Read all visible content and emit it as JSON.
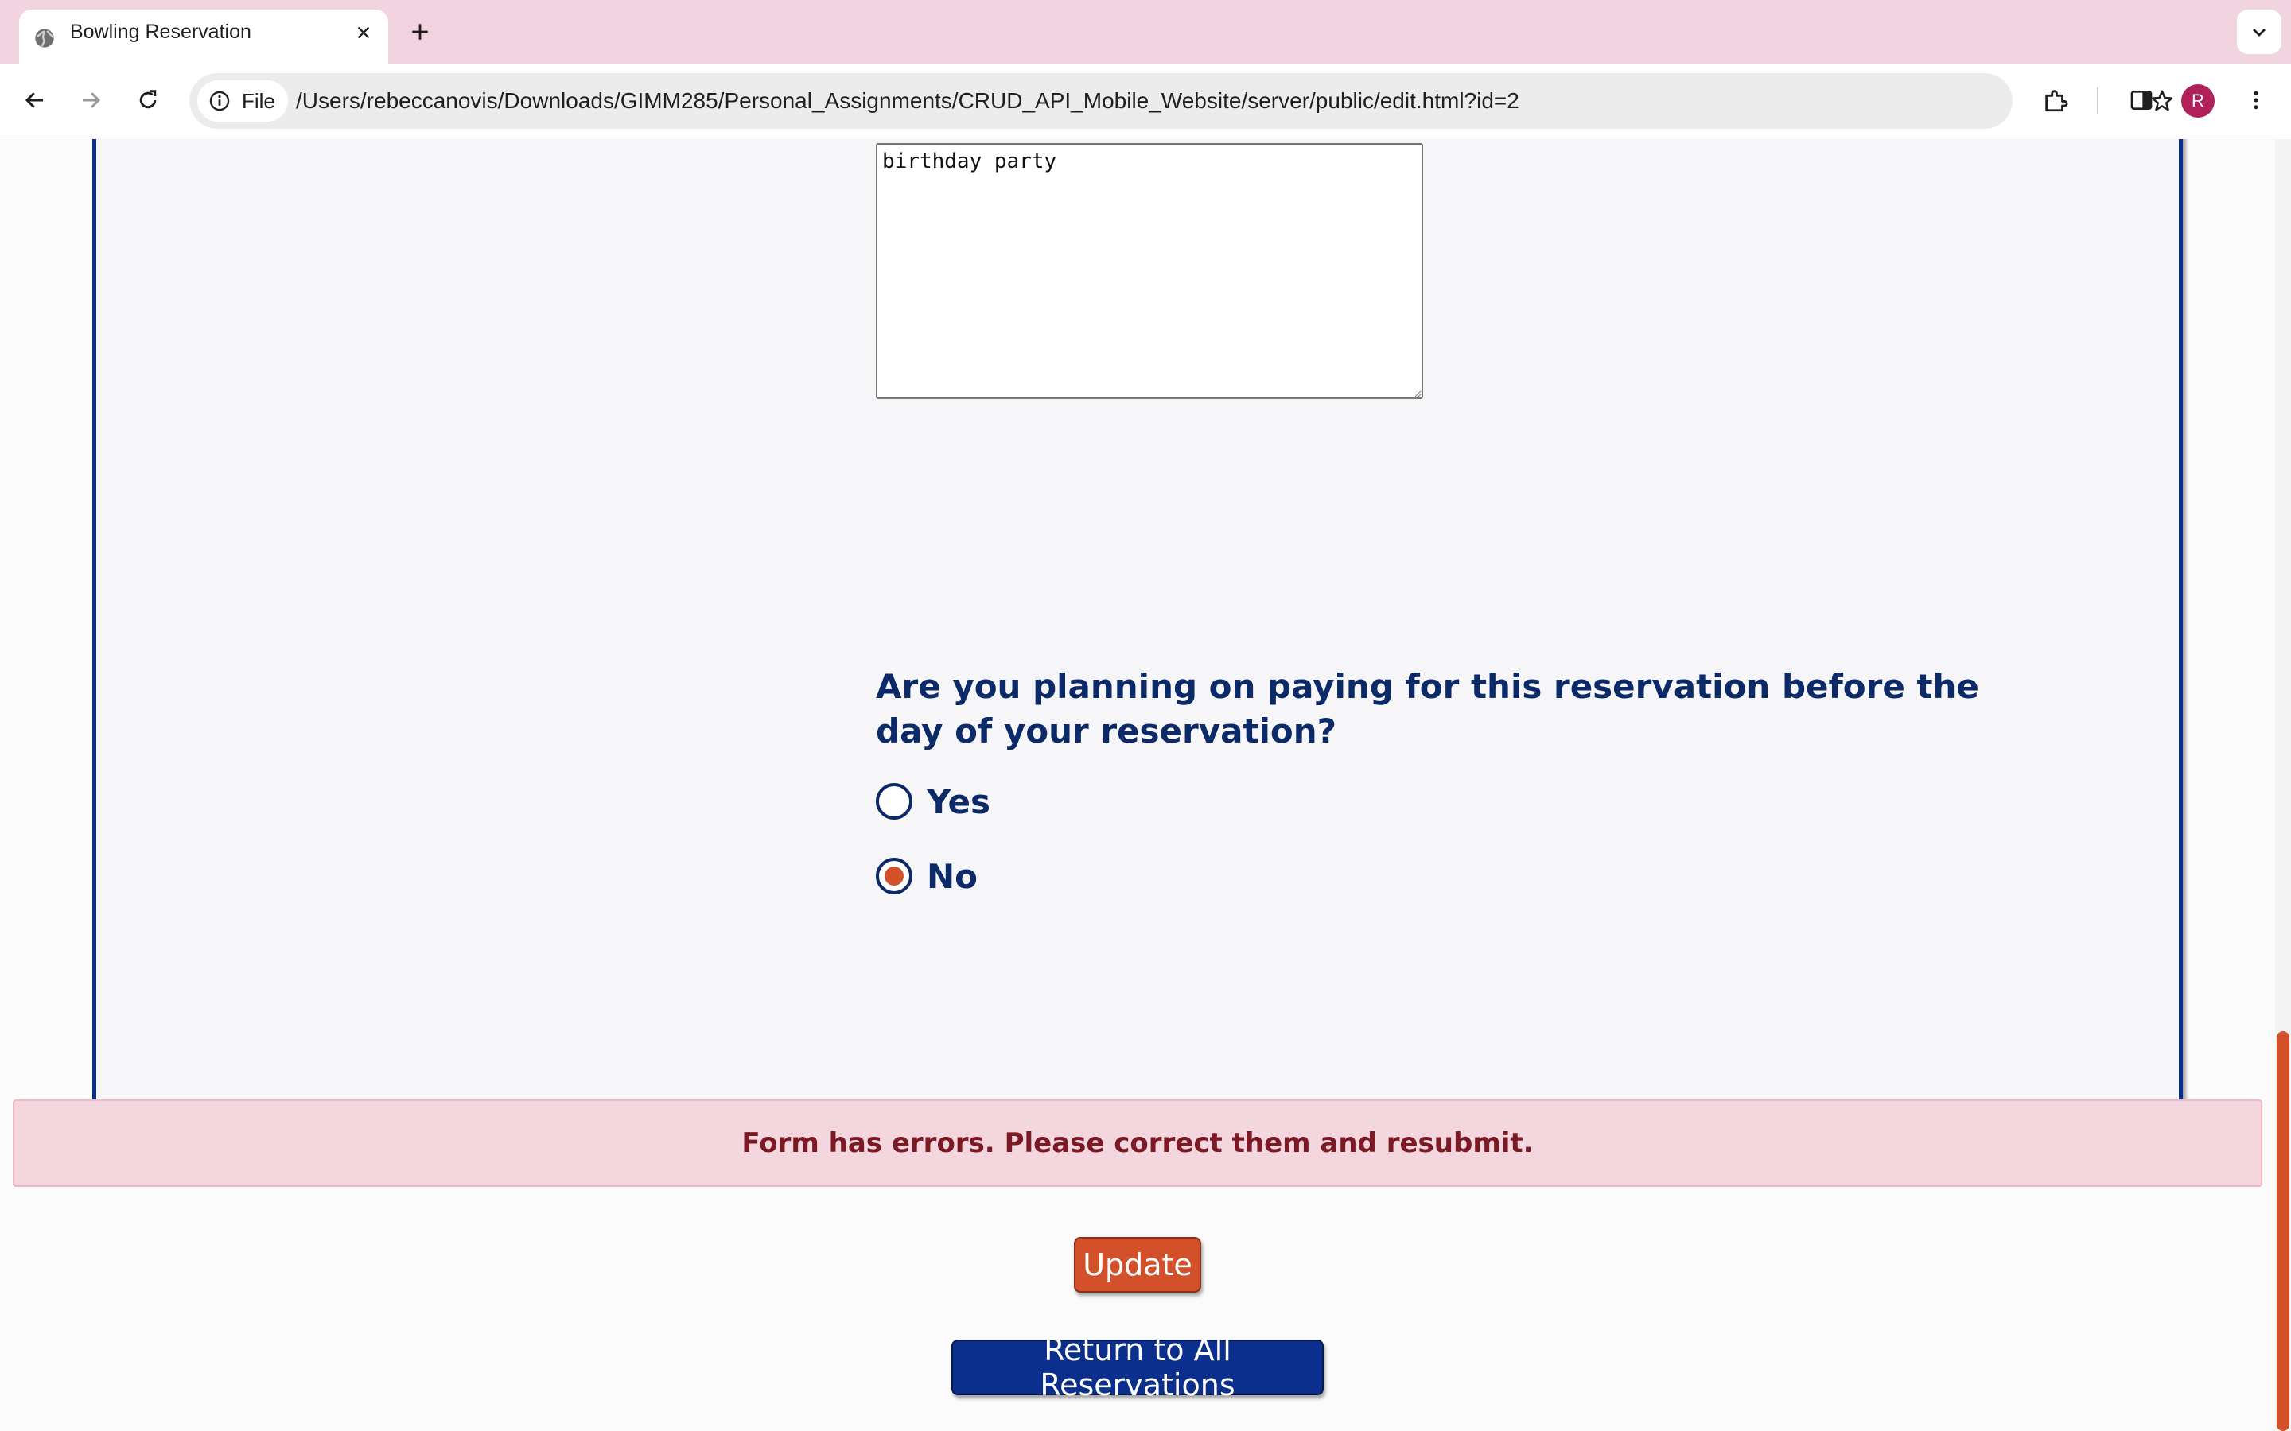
{
  "browser": {
    "tab": {
      "title": "Bowling Reservation",
      "favicon": "globe-icon"
    },
    "site_chip_label": "File",
    "url": "/Users/rebeccanovis/Downloads/GIMM285/Personal_Assignments/CRUD_API_Mobile_Website/server/public/edit.html?id=2",
    "profile_initial": "R",
    "icons": [
      "back-arrow-icon",
      "forward-arrow-icon",
      "reload-icon",
      "info-icon",
      "star-icon",
      "extensions-icon",
      "side-panel-icon",
      "more-vert-icon",
      "close-icon",
      "plus-icon",
      "chevron-down-icon"
    ]
  },
  "form": {
    "notes_value": "birthday party",
    "payment_question": "Are you planning on paying for this reservation before the day of your reservation?",
    "options": [
      {
        "label": "Yes",
        "checked": false
      },
      {
        "label": "No",
        "checked": true
      }
    ]
  },
  "status": {
    "error_message": "Form has errors. Please correct them and resubmit."
  },
  "actions": {
    "update_label": "Update",
    "return_label": "Return to All Reservations"
  },
  "colors": {
    "tabbar": "#f2d4e1",
    "panel_border": "#0b2f8c",
    "heading_text": "#0c2a67",
    "accent_orange": "#d2502a",
    "error_bg": "#f3d6de",
    "error_text": "#7b1a24",
    "avatar": "#b0205a"
  }
}
